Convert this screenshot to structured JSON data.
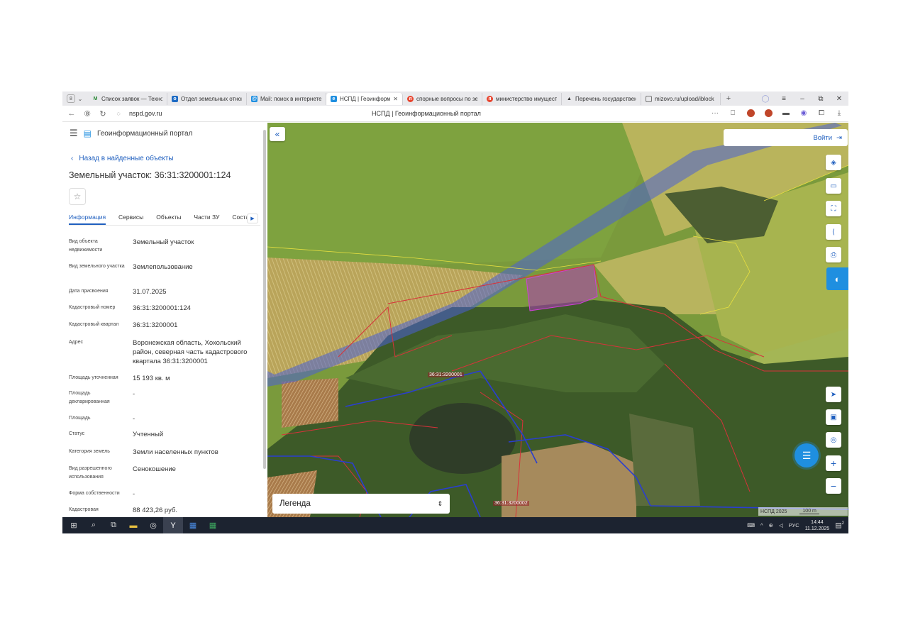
{
  "browser": {
    "tab_count_badge": "8",
    "tabs": [
      {
        "title": "Список заявок — Техно",
        "icon": "gmail-icon",
        "color": "#2e8b3a"
      },
      {
        "title": "Отдел земельных отнош",
        "icon": "outlook-icon",
        "color": "#1d6bc4"
      },
      {
        "title": "Mail: поиск в интернете",
        "icon": "mail-icon",
        "color": "#1f8fe0"
      },
      {
        "title": "НСПД | Геоинформаци",
        "icon": "nspd-icon",
        "color": "#1f8fe0",
        "active": true
      },
      {
        "title": "спорные вопросы по зе",
        "icon": "yandex-icon",
        "color": "#e8442e"
      },
      {
        "title": "министерство имущест",
        "icon": "yandex-icon",
        "color": "#e8442e"
      },
      {
        "title": "Перечень государствен",
        "icon": "doc-icon",
        "color": "#333333"
      },
      {
        "title": "mizovo.ru/upload/iblock",
        "icon": "file-icon",
        "color": "#555555"
      }
    ],
    "url": "nspd.gov.ru",
    "page_title": "НСПД | Геоинформационный портал"
  },
  "panel": {
    "app_title": "Геоинформационный портал",
    "back_link": "Назад в найденные объекты",
    "parcel_title": "Земельный участок: 36:31:3200001:124",
    "tabs": [
      "Информация",
      "Сервисы",
      "Объекты",
      "Части ЗУ",
      "Соста"
    ],
    "properties": [
      {
        "key": "Вид объекта недвижимости",
        "value": "Земельный участок"
      },
      {
        "key": "Вид земельного участка",
        "value": "Землепользование"
      },
      {
        "key": "Дата присвоения",
        "value": "31.07.2025"
      },
      {
        "key": "Кадастровый номер",
        "value": "36:31:3200001:124"
      },
      {
        "key": "Кадастровый квартал",
        "value": "36:31:3200001"
      },
      {
        "key": "Адрес",
        "value": "Воронежская область, Хохольский район, северная часть кадастрового квартала 36:31:3200001"
      },
      {
        "key": "Площадь уточненная",
        "value": "15 193 кв. м"
      },
      {
        "key": "Площадь декларированная",
        "value": "-"
      },
      {
        "key": "Площадь",
        "value": "-"
      },
      {
        "key": "Статус",
        "value": "Учтенный"
      },
      {
        "key": "Категория земель",
        "value": "Земли населенных пунктов"
      },
      {
        "key": "Вид разрешенного использования",
        "value": "Сенокошение"
      },
      {
        "key": "Форма собственности",
        "value": "-"
      },
      {
        "key": "Кадастровая",
        "value": "88 423,26 руб."
      }
    ]
  },
  "map": {
    "login_label": "Войти",
    "legend_label": "Легенда",
    "labels": [
      "36:31:3200001",
      "36:31:3200002"
    ],
    "attribution": "НСПД 2025",
    "scale": "100 m"
  },
  "taskbar": {
    "lang": "РУС",
    "time": "14:44",
    "date": "11.12.2025",
    "notifications": "2"
  }
}
